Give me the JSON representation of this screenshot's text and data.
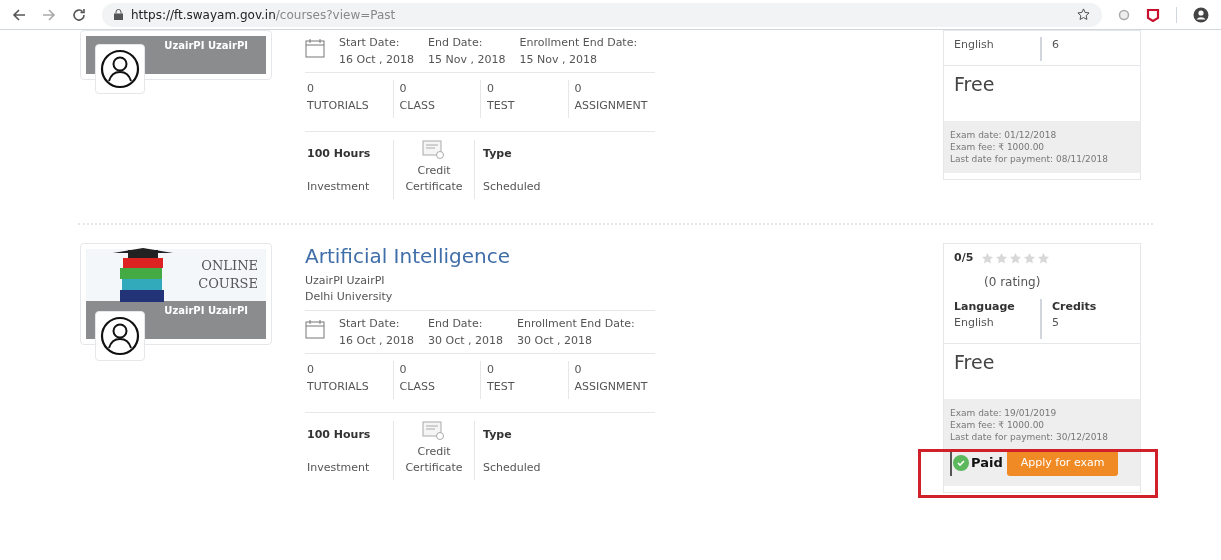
{
  "browser": {
    "url_host": "https://ft.swayam.gov.in",
    "url_path": "/courses?view=Past"
  },
  "courses": [
    {
      "thumbnail": {
        "banner": "UzairPI UzairPI"
      },
      "dates": [
        {
          "label": "Start Date:",
          "value": "16 Oct , 2018"
        },
        {
          "label": "End Date:",
          "value": "15 Nov , 2018"
        },
        {
          "label": "Enrollment End Date:",
          "value": "15 Nov , 2018"
        }
      ],
      "stats": [
        {
          "count": "0",
          "label": "TUTORIALS"
        },
        {
          "count": "0",
          "label": "CLASS"
        },
        {
          "count": "0",
          "label": "TEST"
        },
        {
          "count": "0",
          "label": "ASSIGNMENT"
        }
      ],
      "hours": "100 Hours",
      "hours_label": "Investment",
      "certificate": "Credit Certificate",
      "type_label": "Type",
      "type": "Scheduled",
      "side": {
        "language": "English",
        "credits": "6",
        "price": "Free",
        "exam_info": [
          "Exam date: 01/12/2018",
          "Exam fee: ₹ 1000.00",
          "Last date for payment: 08/11/2018"
        ]
      }
    },
    {
      "thumbnail": {
        "heading": [
          "ONLINE",
          "COURSE"
        ],
        "banner": "UzairPI UzairPI"
      },
      "title": "Artificial Intelligence",
      "instructor": "UzairPI UzairPI",
      "institute": "Delhi University",
      "dates": [
        {
          "label": "Start Date:",
          "value": "16 Oct , 2018"
        },
        {
          "label": "End Date:",
          "value": "30 Oct , 2018"
        },
        {
          "label": "Enrollment End Date:",
          "value": "30 Oct , 2018"
        }
      ],
      "stats": [
        {
          "count": "0",
          "label": "TUTORIALS"
        },
        {
          "count": "0",
          "label": "CLASS"
        },
        {
          "count": "0",
          "label": "TEST"
        },
        {
          "count": "0",
          "label": "ASSIGNMENT"
        }
      ],
      "hours": "100 Hours",
      "hours_label": "Investment",
      "certificate": "Credit Certificate",
      "type_label": "Type",
      "type": "Scheduled",
      "side": {
        "score": "0/5",
        "stars": 0,
        "rating": "(0 rating)",
        "language_label": "Language",
        "language": "English",
        "credits_label": "Credits",
        "credits": "5",
        "price": "Free",
        "exam_info": [
          "Exam date: 19/01/2019",
          "Exam fee: ₹ 1000.00",
          "Last date for payment: 30/12/2018"
        ],
        "payment": {
          "paid": true,
          "label": "Paid"
        },
        "apply_button": "Apply for exam",
        "highlighted": true
      }
    }
  ]
}
